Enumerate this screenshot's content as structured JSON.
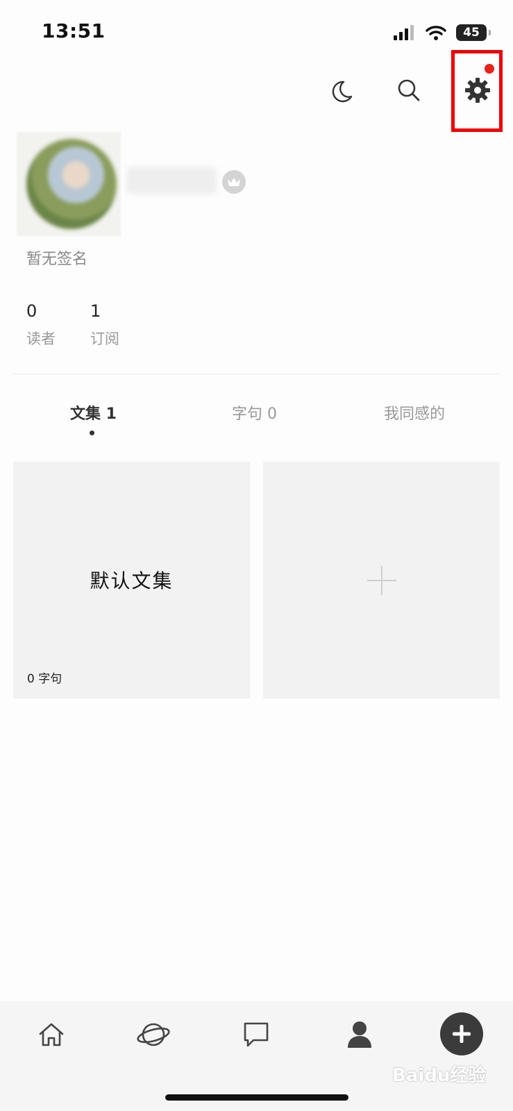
{
  "status_bar": {
    "time": "13:51",
    "battery": "45"
  },
  "profile": {
    "signature": "暂无签名"
  },
  "stats": [
    {
      "value": "0",
      "label": "读者"
    },
    {
      "value": "1",
      "label": "订阅"
    }
  ],
  "tabs": [
    {
      "label": "文集 1",
      "active": true
    },
    {
      "label": "字句 0",
      "active": false
    },
    {
      "label": "我同感的",
      "active": false
    }
  ],
  "collections": [
    {
      "title": "默认文集",
      "count": "0 字句"
    }
  ],
  "watermark": "Baidu经验",
  "colors": {
    "highlight": "#ef0000",
    "notification_dot": "#e8221a",
    "fab": "#3b3b3b"
  }
}
